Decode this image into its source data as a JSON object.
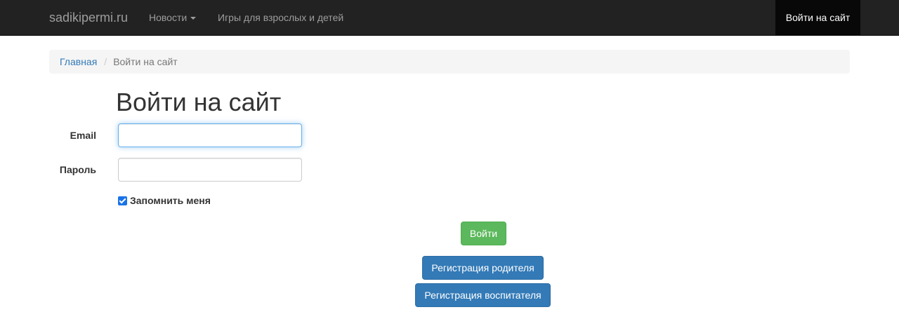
{
  "navbar": {
    "brand": "sadikipermi.ru",
    "news_label": "Новости",
    "games_label": "Игры для взрослых и детей",
    "login_label": "Войти на сайт"
  },
  "breadcrumb": {
    "home": "Главная",
    "separator": "/",
    "current": "Войти на сайт"
  },
  "page": {
    "title": "Войти на сайт"
  },
  "form": {
    "email_label": "Email",
    "email_value": "",
    "password_label": "Пароль",
    "password_value": "",
    "remember_label": "Запомнить меня",
    "remember_checked": true,
    "submit_label": "Войти",
    "register_parent_label": "Регистрация родителя",
    "register_teacher_label": "Регистрация воспитателя"
  },
  "colors": {
    "navbar_bg": "#222222",
    "link": "#337ab7",
    "success": "#5cb85c",
    "primary": "#337ab7"
  }
}
